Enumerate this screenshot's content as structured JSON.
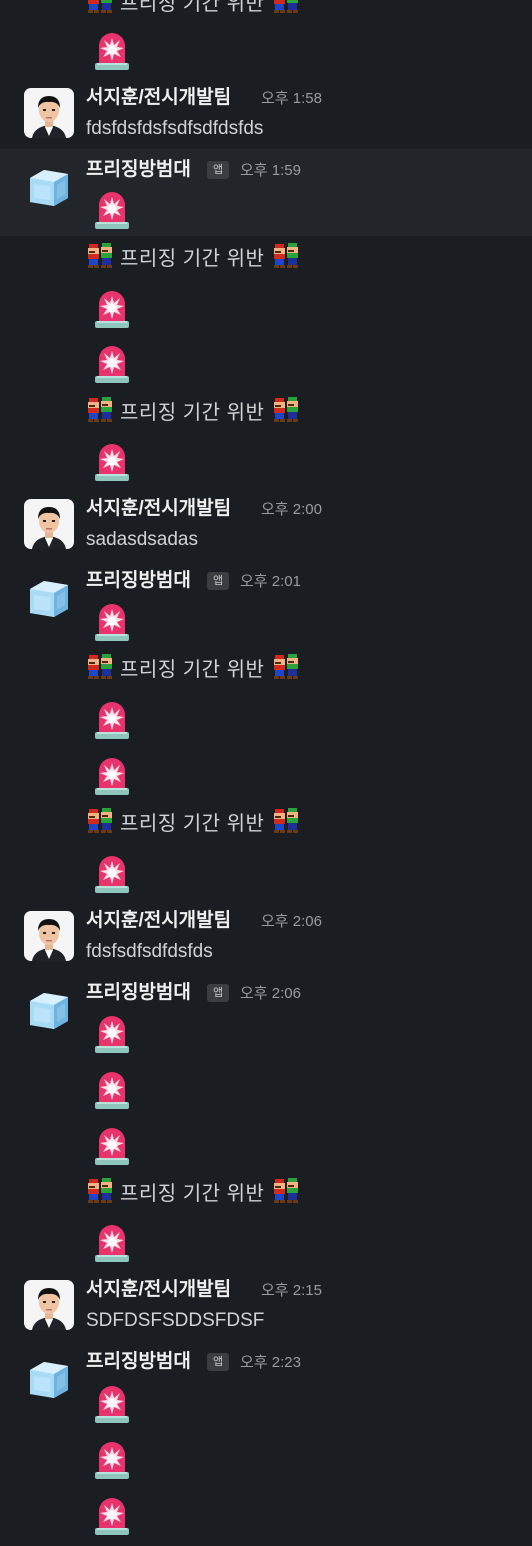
{
  "users": {
    "human": {
      "name": "서지훈/전시개발팀"
    },
    "bot": {
      "name": "프리징방범대",
      "badge": "앱"
    }
  },
  "icons": {
    "siren": "rotating-light-emoji",
    "mario": "mario-luigi-emoji",
    "human_avatar": "person-photo-avatar",
    "bot_avatar": "ice-cube-avatar"
  },
  "colors": {
    "background": "#1a1d21",
    "highlight_row": "#222529",
    "name": "#f0f0f0",
    "time": "#9a9b9d",
    "siren_red": "#e8336c"
  },
  "freeze_text": "프리징 기간 위반",
  "messages": [
    {
      "author": "human",
      "time": "오후 1:58",
      "text": "fdsfdsfdsfsdfsdfdsfds"
    },
    {
      "author": "bot",
      "time": "오후 1:59"
    },
    {
      "author": "human",
      "time": "오후 2:00",
      "text": "sadasdsadas"
    },
    {
      "author": "bot",
      "time": "오후 2:01"
    },
    {
      "author": "human",
      "time": "오후 2:06",
      "text": "fdsfsdfsdfdsfds"
    },
    {
      "author": "bot",
      "time": "오후 2:06"
    },
    {
      "author": "human",
      "time": "오후 2:15",
      "text": "SDFDSFSDDSFDSF"
    },
    {
      "author": "bot",
      "time": "오후 2:23"
    }
  ]
}
